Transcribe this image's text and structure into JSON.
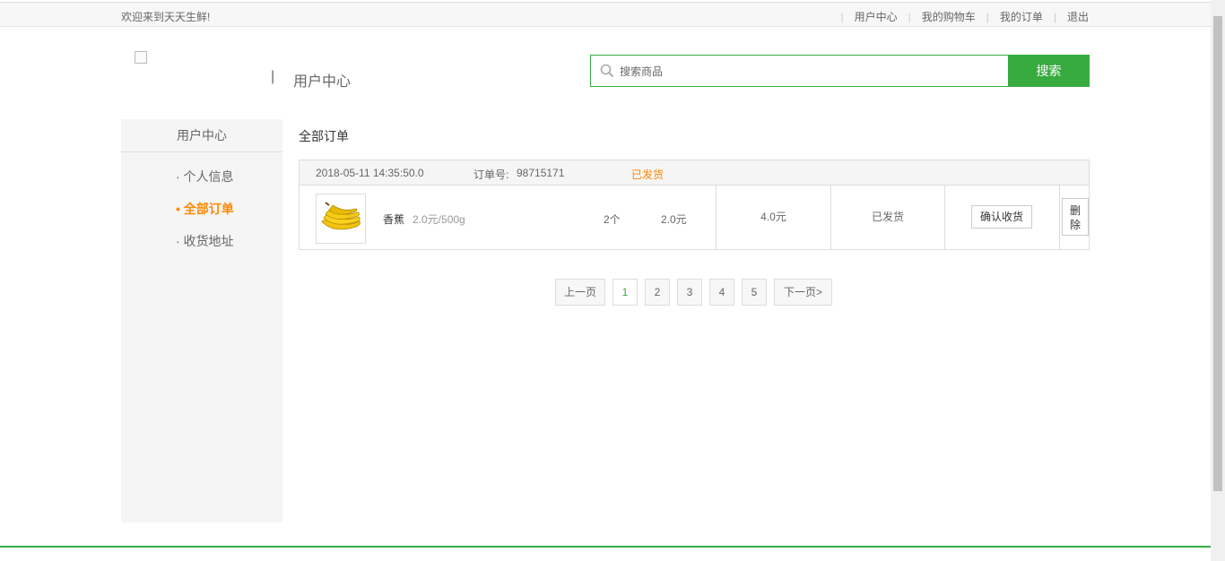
{
  "topbar": {
    "welcome": "欢迎来到天天生鲜!",
    "links": [
      "用户中心",
      "我的购物车",
      "我的订单",
      "退出"
    ]
  },
  "brand": {
    "separator": "|",
    "title": "用户中心"
  },
  "search": {
    "placeholder": "搜索商品",
    "button": "搜索",
    "accent": "#37ab40"
  },
  "sidebar": {
    "title": "用户中心",
    "items": [
      {
        "label": "· 个人信息"
      },
      {
        "label": "• 全部订单"
      },
      {
        "label": "· 收货地址"
      }
    ]
  },
  "main": {
    "title": "全部订单"
  },
  "order": {
    "date": "2018-05-11 14:35:50.0",
    "number_label": "订单号:",
    "number": "98715171",
    "status": "已发货",
    "goods": {
      "name": "香蕉",
      "price": "2.0元/500g",
      "qty": "2个",
      "subtotal": "2.0元"
    },
    "total": "4.0元",
    "state": "已发货",
    "confirm": "确认收货",
    "delete": "删除"
  },
  "pager": {
    "prev": "上一页",
    "pages": [
      "1",
      "2",
      "3",
      "4",
      "5"
    ],
    "next": "下一页>"
  },
  "colors": {
    "highlight": "#ff8800",
    "green": "#37ab40"
  }
}
